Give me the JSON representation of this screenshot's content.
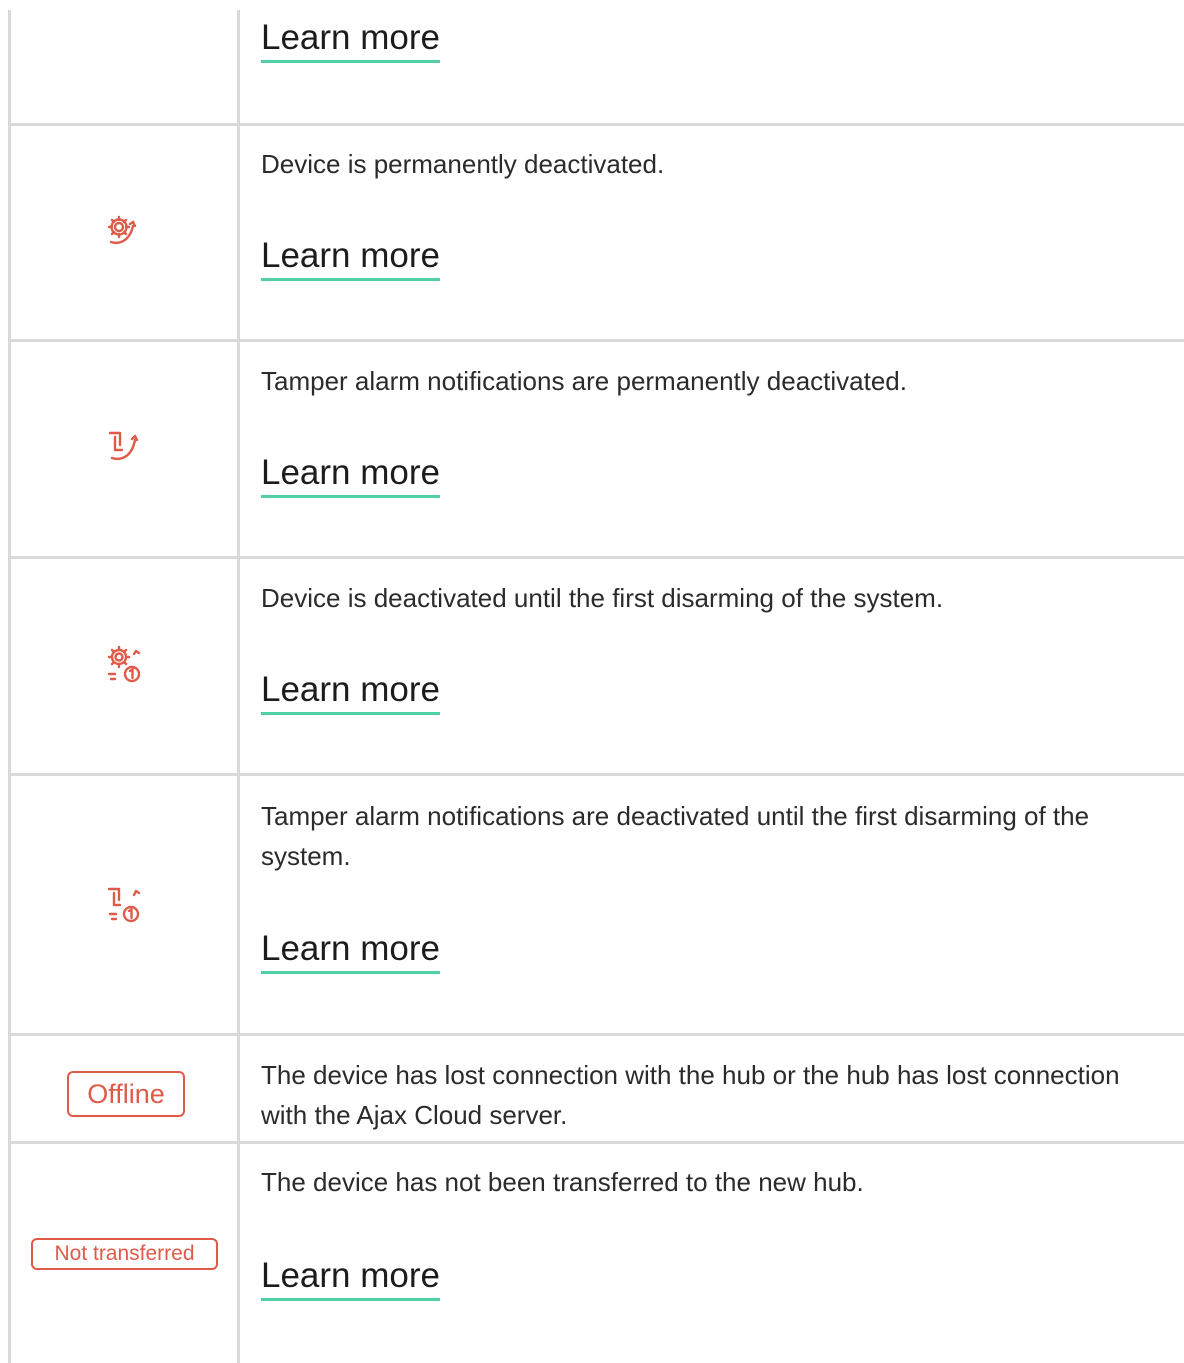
{
  "rows": [
    {
      "id": "top",
      "learn_more": "Learn more"
    },
    {
      "id": "device-perm",
      "icon": "gear-deactivated-icon",
      "description": "Device is permanently deactivated.",
      "learn_more": "Learn more"
    },
    {
      "id": "tamper-perm",
      "icon": "tamper-deactivated-icon",
      "description": "Tamper alarm notifications are permanently deactivated.",
      "learn_more": "Learn more"
    },
    {
      "id": "device-until-disarm",
      "icon": "gear-deactivated-once-icon",
      "description": "Device is deactivated until the first disarming of the system.",
      "learn_more": "Learn more"
    },
    {
      "id": "tamper-until-disarm",
      "icon": "tamper-deactivated-once-icon",
      "description": "Tamper alarm notifications are deactivated until the first disarming of the system.",
      "learn_more": "Learn more"
    },
    {
      "id": "offline",
      "badge": "Offline",
      "description": "The device has lost connection with the hub or the hub has lost connection with the Ajax Cloud server."
    },
    {
      "id": "not-transferred",
      "badge": "Not transferred",
      "description": "The device has not been transferred to the new hub.",
      "learn_more": "Learn more"
    }
  ],
  "colors": {
    "icon": "#e05a4a",
    "link_underline": "#4fd1a5",
    "border": "#d9d9d9",
    "text": "#2b2b2b"
  }
}
